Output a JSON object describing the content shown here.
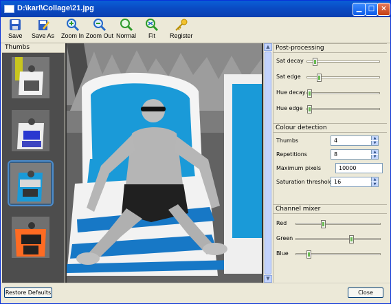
{
  "window": {
    "title": "D:\\karl\\Collage\\21.jpg"
  },
  "toolbar": {
    "items": [
      {
        "label": "Save",
        "icon": "floppy-disk-icon"
      },
      {
        "label": "Save As",
        "icon": "save-as-icon"
      },
      {
        "label": "Zoom In",
        "icon": "zoom-in-icon"
      },
      {
        "label": "Zoom Out",
        "icon": "zoom-out-icon"
      },
      {
        "label": "Normal",
        "icon": "zoom-normal-icon"
      },
      {
        "label": "Fit",
        "icon": "zoom-fit-icon"
      },
      {
        "label": "Register",
        "icon": "key-icon"
      }
    ]
  },
  "thumbs": {
    "title": "Thumbs",
    "selected_index": 2
  },
  "post_processing": {
    "title": "Post-processing",
    "sliders": [
      {
        "label": "Sat decay",
        "value": 0.08
      },
      {
        "label": "Sat edge",
        "value": 0.14
      },
      {
        "label": "Hue decay",
        "value": 0.0
      },
      {
        "label": "Hue edge",
        "value": 0.0
      }
    ]
  },
  "colour_detection": {
    "title": "Colour detection",
    "thumbs_label": "Thumbs",
    "thumbs_value": "4",
    "repetitions_label": "Repetitions",
    "repetitions_value": "8",
    "maximum_pixels_label": "Maximum pixels",
    "maximum_pixels_value": "10000",
    "saturation_threshold_label": "Saturation threshold",
    "saturation_threshold_value": "16"
  },
  "channel_mixer": {
    "title": "Channel mixer",
    "sliders": [
      {
        "label": "Red",
        "value": 0.31
      },
      {
        "label": "Green",
        "value": 0.67
      },
      {
        "label": "Blue",
        "value": 0.13
      }
    ]
  },
  "buttons": {
    "restore_defaults": "Restore Defaults",
    "close": "Close"
  },
  "colors": {
    "title_bar": "#0a4bc4",
    "photo_accent_blue": "#1a9ad8",
    "thumb_selection": "#4c8ccc"
  }
}
